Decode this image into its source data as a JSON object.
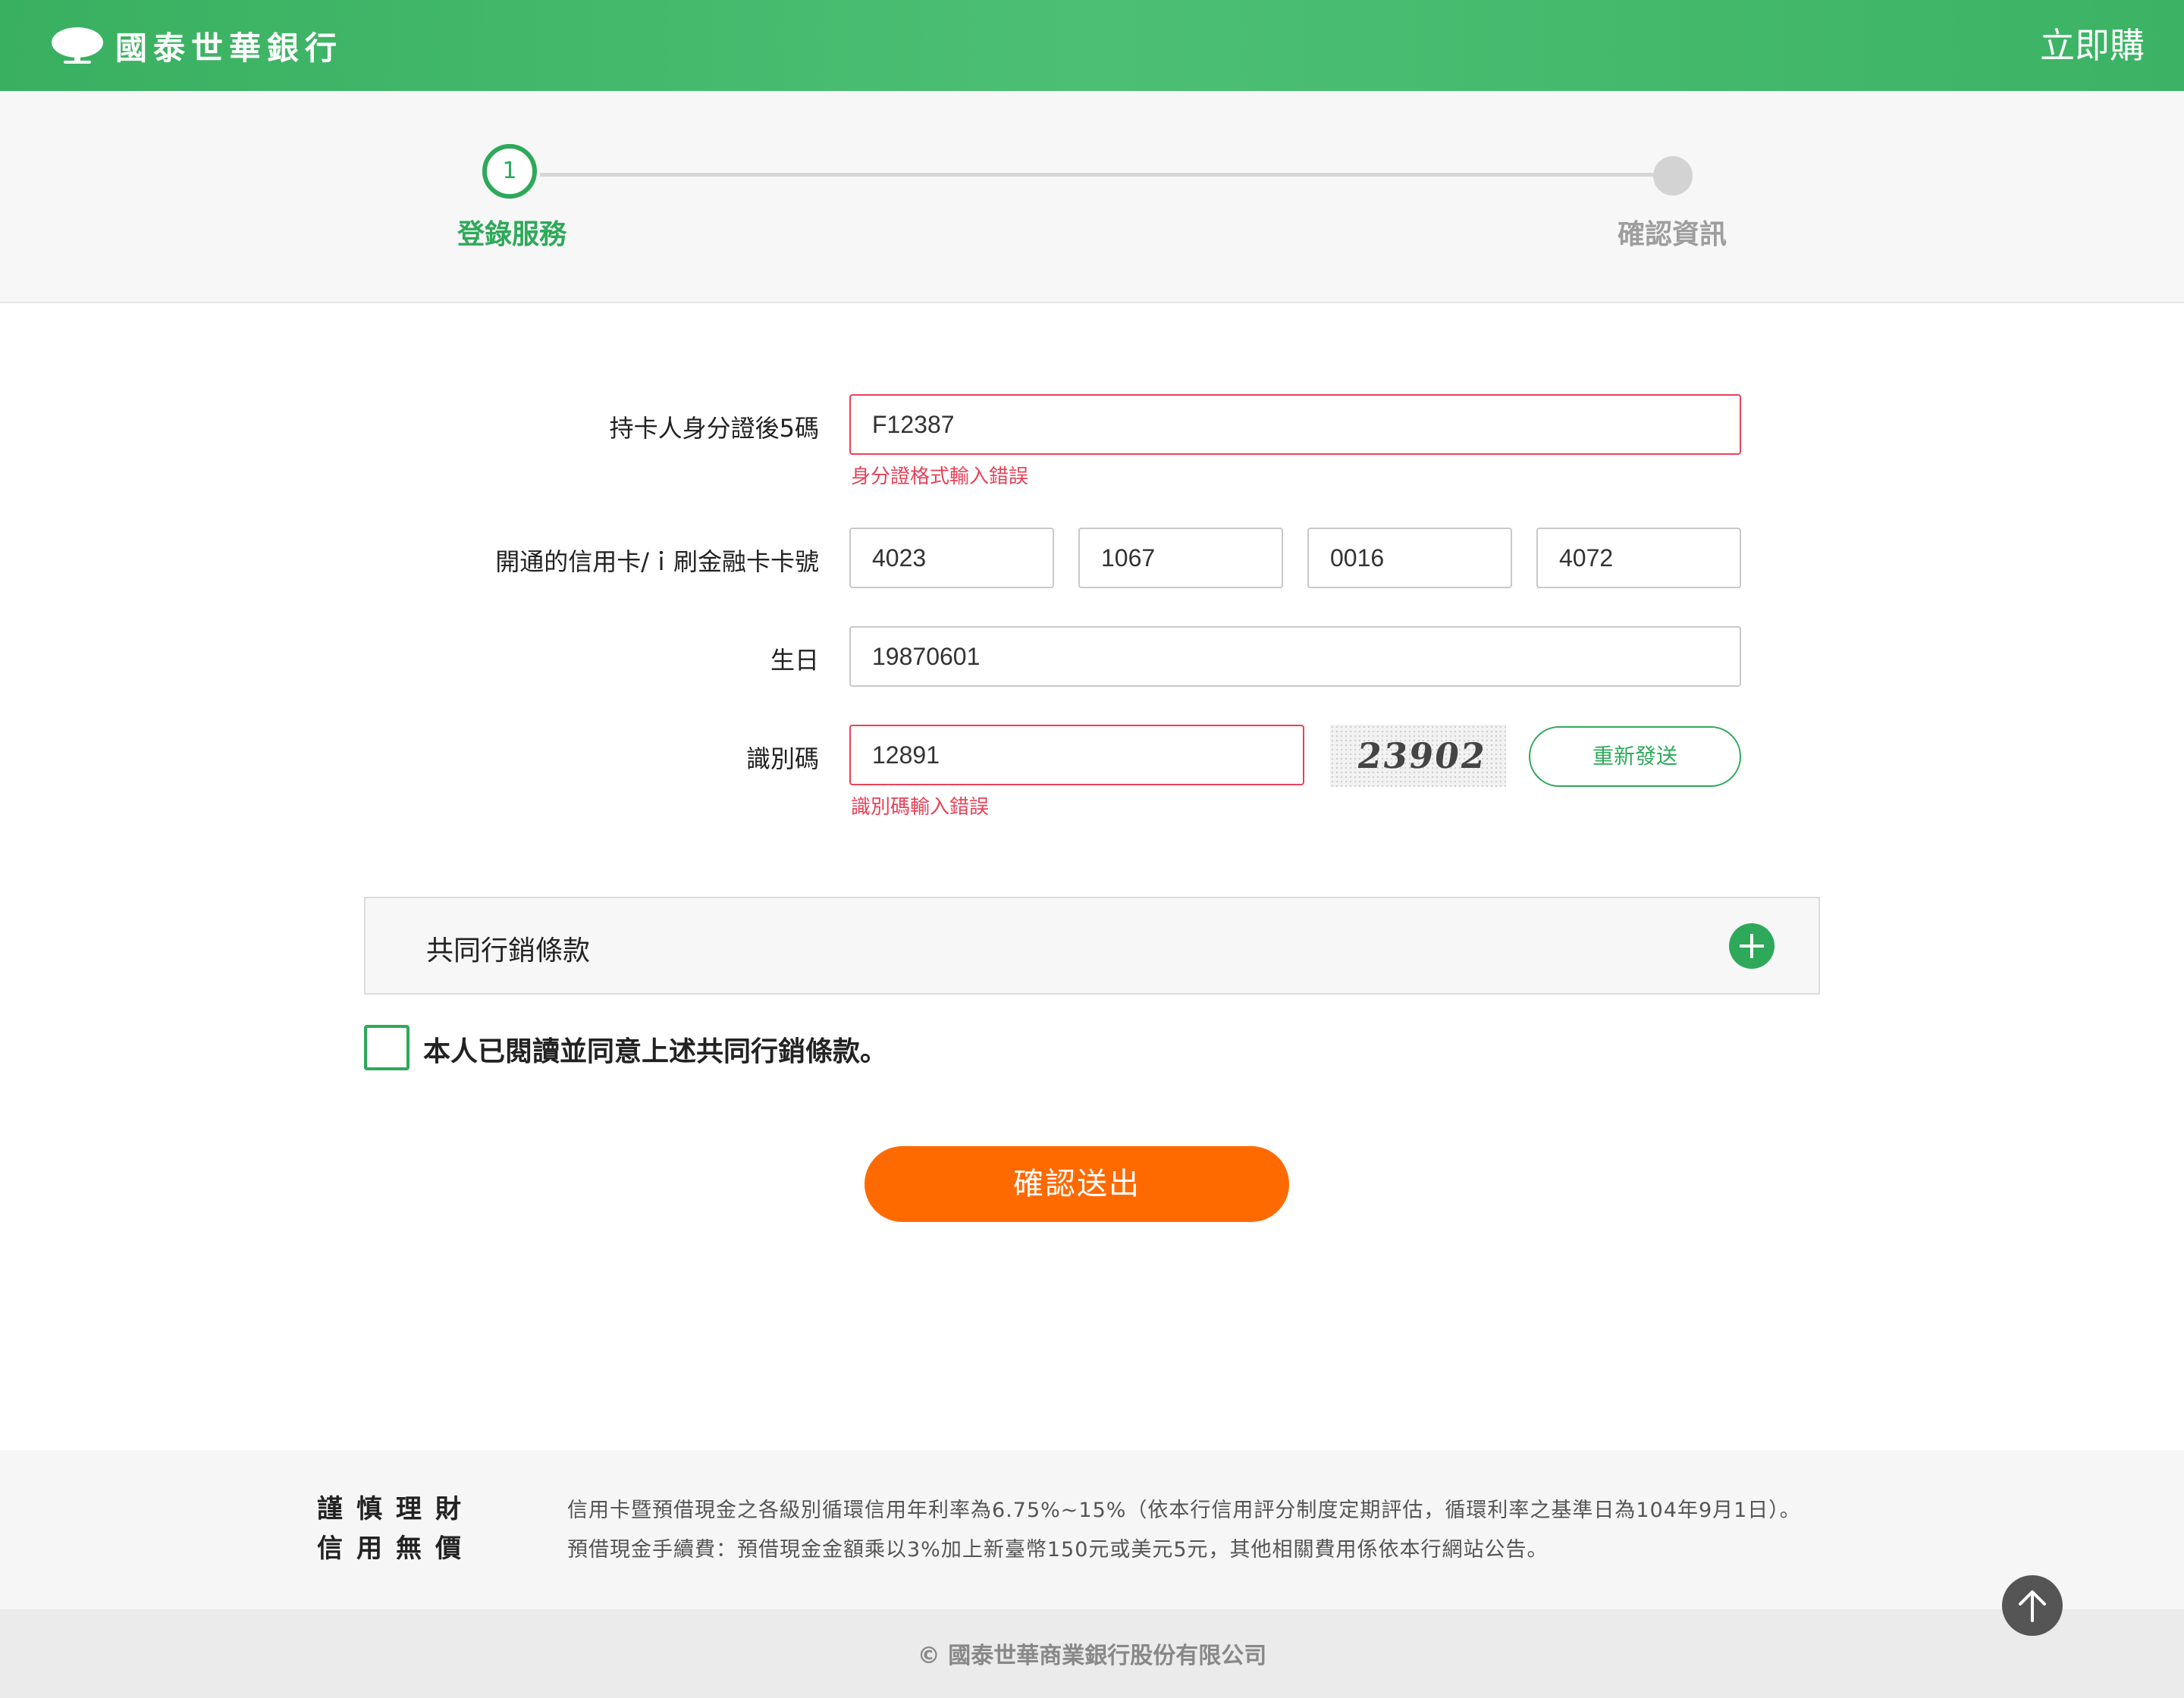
{
  "header": {
    "logo_text": "國泰世華銀行",
    "buy_label": "立即購"
  },
  "steps": [
    {
      "number": "1",
      "label": "登錄服務",
      "state": "active"
    },
    {
      "number": "",
      "label": "確認資訊",
      "state": "inactive"
    }
  ],
  "form": {
    "id_label": "持卡人身分證後5碼",
    "id_value": "F12387",
    "id_error": "身分證格式輸入錯誤",
    "card_label": "開通的信用卡/ｉ刷金融卡卡號",
    "card_segments": [
      "4023",
      "1067",
      "0016",
      "4072"
    ],
    "birthday_label": "生日",
    "birthday_value": "19870601",
    "code_label": "識別碼",
    "code_value": "12891",
    "code_error": "識別碼輸入錯誤",
    "captcha_text": "23902",
    "resend_label": "重新發送"
  },
  "terms": {
    "title": "共同行銷條款",
    "agree_text": "本人已閱讀並同意上述共同行銷條款。",
    "agree_checked": false
  },
  "submit_label": "確認送出",
  "footer": {
    "caution_line1": "謹慎理財",
    "caution_line2": "信用無價",
    "notice_line1": "信用卡暨預借現金之各級別循環信用年利率為6.75%~15%（依本行信用評分制度定期評估，循環利率之基準日為104年9月1日）。",
    "notice_line2": "預借現金手續費：預借現金金額乘以3%加上新臺幣150元或美元5元，其他相關費用係依本行網站公告。",
    "copyright": "© 國泰世華商業銀行股份有限公司"
  },
  "colors": {
    "brand_green": "#2ea95a",
    "error_red": "#e6435a",
    "submit_orange": "#ff6a00"
  },
  "icons": {
    "logo": "tree-logo-icon",
    "expand": "plus-icon",
    "scroll_top": "arrow-up-icon"
  }
}
